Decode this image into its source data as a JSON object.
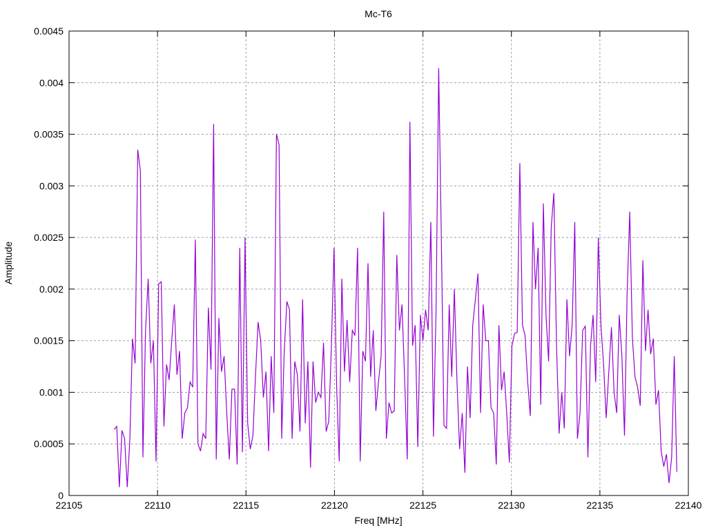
{
  "chart_data": {
    "type": "line",
    "title": "Mc-T6",
    "xlabel": "Freq [MHz]",
    "ylabel": "Amplitude",
    "xlim": [
      22105,
      22140
    ],
    "ylim": [
      0,
      0.0045
    ],
    "xticks": [
      "22105",
      "22110",
      "22115",
      "22120",
      "22125",
      "22130",
      "22135",
      "22140"
    ],
    "yticks": [
      "0",
      "0.0005",
      "0.001",
      "0.0015",
      "0.002",
      "0.0025",
      "0.003",
      "0.0035",
      "0.004",
      "0.0045"
    ],
    "grid": true,
    "legend": "none",
    "series": [
      {
        "name": "Mc-T6",
        "color": "#9400d3",
        "x_start": 22107.55,
        "x_end": 22139.35,
        "y": [
          0.00064,
          0.00067,
          8e-05,
          0.00063,
          0.00055,
          8e-05,
          0.00055,
          0.00152,
          0.00128,
          0.00335,
          0.00315,
          0.00037,
          0.0016,
          0.0021,
          0.00128,
          0.0015,
          0.00033,
          0.00205,
          0.00207,
          0.00067,
          0.00127,
          0.00112,
          0.0015,
          0.00185,
          0.00117,
          0.0014,
          0.00055,
          0.0008,
          0.00085,
          0.0011,
          0.00105,
          0.00248,
          0.0005,
          0.00043,
          0.0006,
          0.00055,
          0.00182,
          0.00122,
          0.0036,
          0.00035,
          0.00172,
          0.0012,
          0.00135,
          0.0008,
          0.00035,
          0.00103,
          0.00103,
          0.0003,
          0.0024,
          0.00042,
          0.0025,
          0.0007,
          0.00045,
          0.00058,
          0.00115,
          0.00168,
          0.0015,
          0.00095,
          0.0012,
          0.00043,
          0.00135,
          0.0008,
          0.0035,
          0.0034,
          0.00055,
          0.0014,
          0.00188,
          0.0018,
          0.00055,
          0.0013,
          0.00117,
          0.00062,
          0.0019,
          0.0007,
          0.0013,
          0.00027,
          0.0013,
          0.0009,
          0.001,
          0.00095,
          0.00148,
          0.00062,
          0.00072,
          0.00145,
          0.0024,
          0.00105,
          0.00033,
          0.0021,
          0.0012,
          0.0017,
          0.0011,
          0.0016,
          0.00155,
          0.0024,
          0.00033,
          0.0014,
          0.0013,
          0.00225,
          0.00115,
          0.0016,
          0.00082,
          0.0011,
          0.00135,
          0.00275,
          0.00055,
          0.0009,
          0.0008,
          0.00082,
          0.00233,
          0.0016,
          0.00185,
          0.00112,
          0.00035,
          0.00362,
          0.00145,
          0.00165,
          0.00047,
          0.00175,
          0.0015,
          0.0018,
          0.0016,
          0.00265,
          0.00057,
          0.0018,
          0.00414,
          0.0025,
          0.00068,
          0.00065,
          0.00185,
          0.00115,
          0.002,
          0.0011,
          0.00045,
          0.0008,
          0.00022,
          0.00125,
          0.00075,
          0.00165,
          0.0019,
          0.00215,
          0.0008,
          0.00185,
          0.0015,
          0.0015,
          0.00085,
          0.0008,
          0.0003,
          0.00165,
          0.00102,
          0.0012,
          0.0008,
          0.00032,
          0.00145,
          0.00157,
          0.00158,
          0.00322,
          0.00165,
          0.00155,
          0.0011,
          0.00077,
          0.00265,
          0.002,
          0.0024,
          0.00088,
          0.00283,
          0.00175,
          0.0013,
          0.0026,
          0.00293,
          0.00147,
          0.0006,
          0.001,
          0.00065,
          0.0019,
          0.00135,
          0.00165,
          0.00265,
          0.00055,
          0.0008,
          0.0016,
          0.00164,
          0.00037,
          0.00145,
          0.00175,
          0.0011,
          0.0025,
          0.00165,
          0.00127,
          0.00075,
          0.0012,
          0.00163,
          0.001,
          0.0008,
          0.00175,
          0.00135,
          0.00058,
          0.00195,
          0.00275,
          0.00153,
          0.00115,
          0.00105,
          0.00087,
          0.00228,
          0.0014,
          0.0018,
          0.00137,
          0.00152,
          0.00088,
          0.00102,
          0.00043,
          0.00028,
          0.0004,
          0.00012,
          0.00037,
          0.00135,
          0.00023
        ]
      }
    ]
  }
}
